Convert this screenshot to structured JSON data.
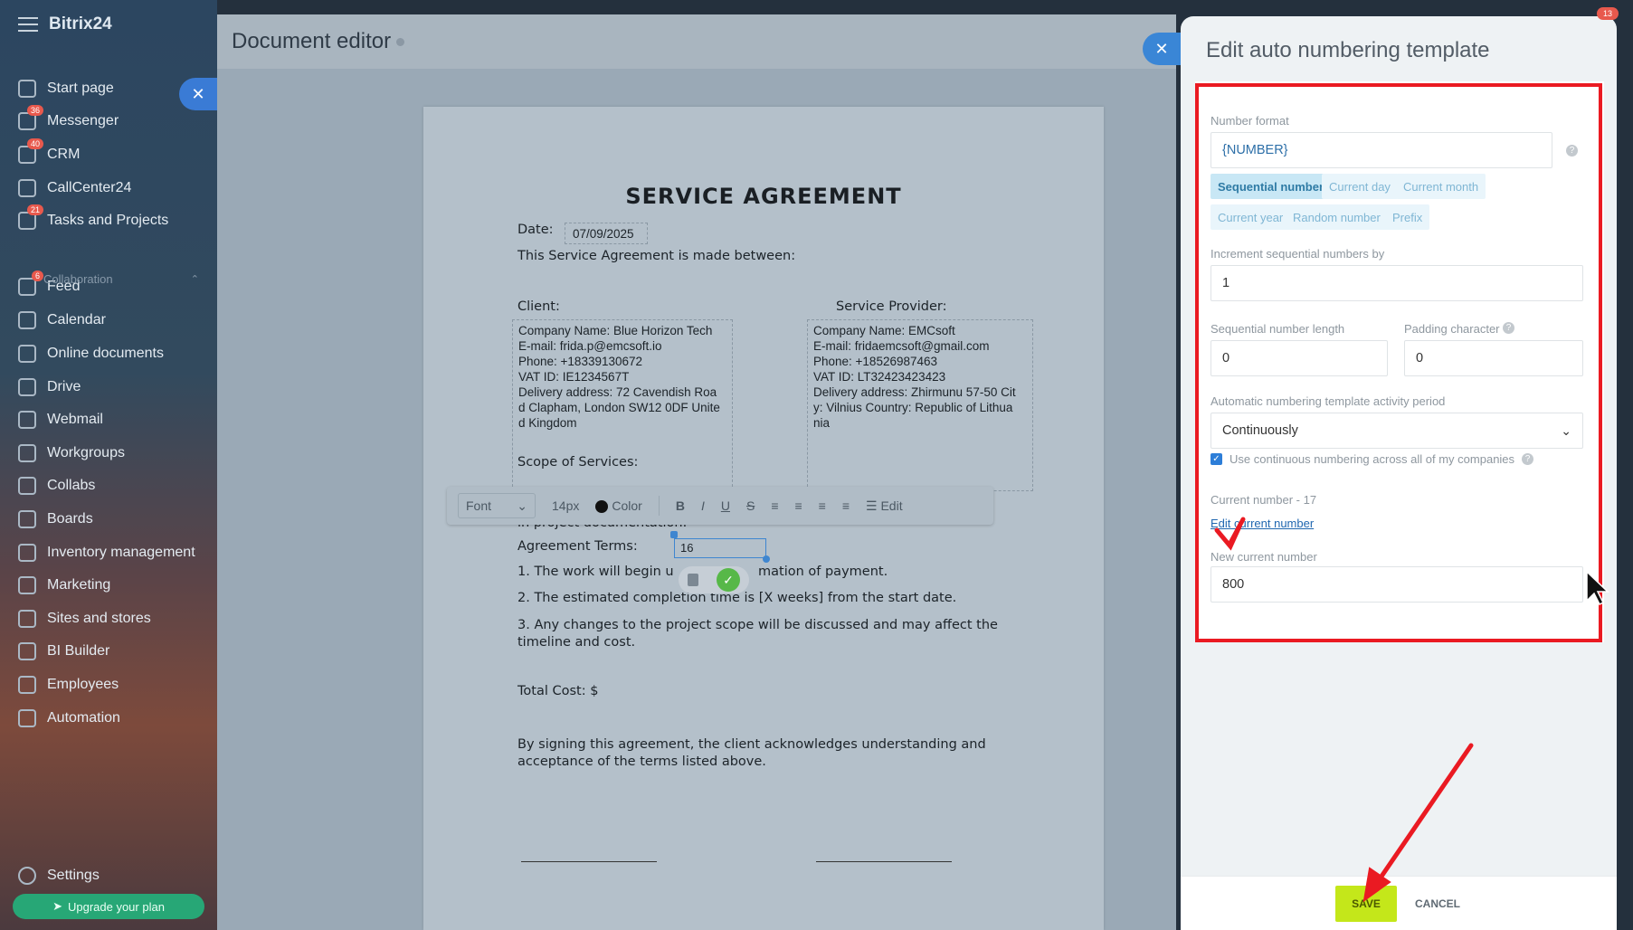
{
  "app": {
    "brand": "Bitrix24",
    "notification_count": "13"
  },
  "sidebar": {
    "items": [
      {
        "label": "Start page",
        "icon": "home-icon",
        "count": ""
      },
      {
        "label": "Messenger",
        "icon": "chat-icon",
        "count": "36"
      },
      {
        "label": "CRM",
        "icon": "crm-icon",
        "count": "40"
      },
      {
        "label": "CallCenter24",
        "icon": "phone-icon",
        "count": ""
      },
      {
        "label": "Tasks and Projects",
        "icon": "tasks-icon",
        "count": "21"
      },
      {
        "label": "Feed",
        "icon": "feed-icon",
        "count": "6"
      },
      {
        "label": "Calendar",
        "icon": "calendar-icon",
        "count": ""
      },
      {
        "label": "Online documents",
        "icon": "document-icon",
        "count": ""
      },
      {
        "label": "Drive",
        "icon": "drive-icon",
        "count": ""
      },
      {
        "label": "Webmail",
        "icon": "mail-icon",
        "count": ""
      },
      {
        "label": "Workgroups",
        "icon": "group-icon",
        "count": ""
      },
      {
        "label": "Collabs",
        "icon": "collab-icon",
        "count": ""
      },
      {
        "label": "Boards",
        "icon": "board-icon",
        "count": ""
      },
      {
        "label": "Inventory management",
        "icon": "inventory-icon",
        "count": ""
      },
      {
        "label": "Marketing",
        "icon": "marketing-icon",
        "count": ""
      },
      {
        "label": "Sites and stores",
        "icon": "cart-icon",
        "count": ""
      },
      {
        "label": "BI Builder",
        "icon": "chart-icon",
        "count": ""
      },
      {
        "label": "Employees",
        "icon": "employees-icon",
        "count": ""
      },
      {
        "label": "Automation",
        "icon": "automation-icon",
        "count": ""
      }
    ],
    "group_label": "Collaboration",
    "settings_label": "Settings",
    "upgrade_label": "Upgrade your plan"
  },
  "editor": {
    "title": "Document editor",
    "doc": {
      "heading": "SERVICE AGREEMENT",
      "date_label": "Date:",
      "date_value": "07/09/2025",
      "intro": "This Service Agreement is made between:",
      "client_label": "Client:",
      "provider_label": "Service Provider:",
      "client_lines": [
        "Company Name: Blue Horizon Tech",
        "E-mail: frida.p@emcsoft.io",
        "Phone: +18339130672",
        "VAT ID: IE1234567T",
        "Delivery address: 72 Cavendish Roa d Clapham, London SW12 0DF Unite d Kingdom"
      ],
      "provider_lines": [
        "Company Name: EMCsoft",
        "E-mail: fridaemcsoft@gmail.com",
        "Phone: +18526987463",
        "VAT ID: LT32423423423",
        "Delivery address: Zhirmunu 57-50 Cit y: Vilnius Country: Republic of Lithua nia"
      ],
      "scope_label": "Scope of Services:",
      "scope_partial": "in project documentation.",
      "terms_label": "Agreement Terms:",
      "terms_field": "16",
      "term1_a": "1. The work will begin u",
      "term1_b": "mation of payment.",
      "term2": "2. The estimated completion time is [X weeks] from the start date.",
      "term3": "3. Any changes to the project scope will be discussed and may affect the timeline and cost.",
      "total": "Total Cost: $",
      "closing": "By signing this agreement, the client acknowledges understanding and acceptance of the terms listed above."
    },
    "toolbar": {
      "font": "Font",
      "size": "14px",
      "color": "Color",
      "bold": "B",
      "italic": "I",
      "underline": "U",
      "strike": "S",
      "edit": "Edit"
    }
  },
  "panel": {
    "title": "Edit auto numbering template",
    "number_format_label": "Number format",
    "number_format_value": "{NUMBER}",
    "chips": [
      "Sequential numbers",
      "Current day",
      "Current month",
      "Current year",
      "Random number",
      "Prefix"
    ],
    "increment_label": "Increment sequential numbers by",
    "increment_value": "1",
    "length_label": "Sequential number length",
    "length_value": "0",
    "padding_label": "Padding character",
    "padding_value": "0",
    "period_label": "Automatic numbering template activity period",
    "period_value": "Continuously",
    "continuous_label": "Use continuous numbering across all of my companies",
    "current_number_text": "Current number - 17",
    "edit_current_link": "Edit current number",
    "new_current_label": "New current number",
    "new_current_value": "800",
    "save_label": "SAVE",
    "cancel_label": "CANCEL"
  },
  "colors": {
    "save_button": "#c4e71a",
    "highlight_box": "#ea1a22",
    "chip_active": "#c8e7f5"
  }
}
